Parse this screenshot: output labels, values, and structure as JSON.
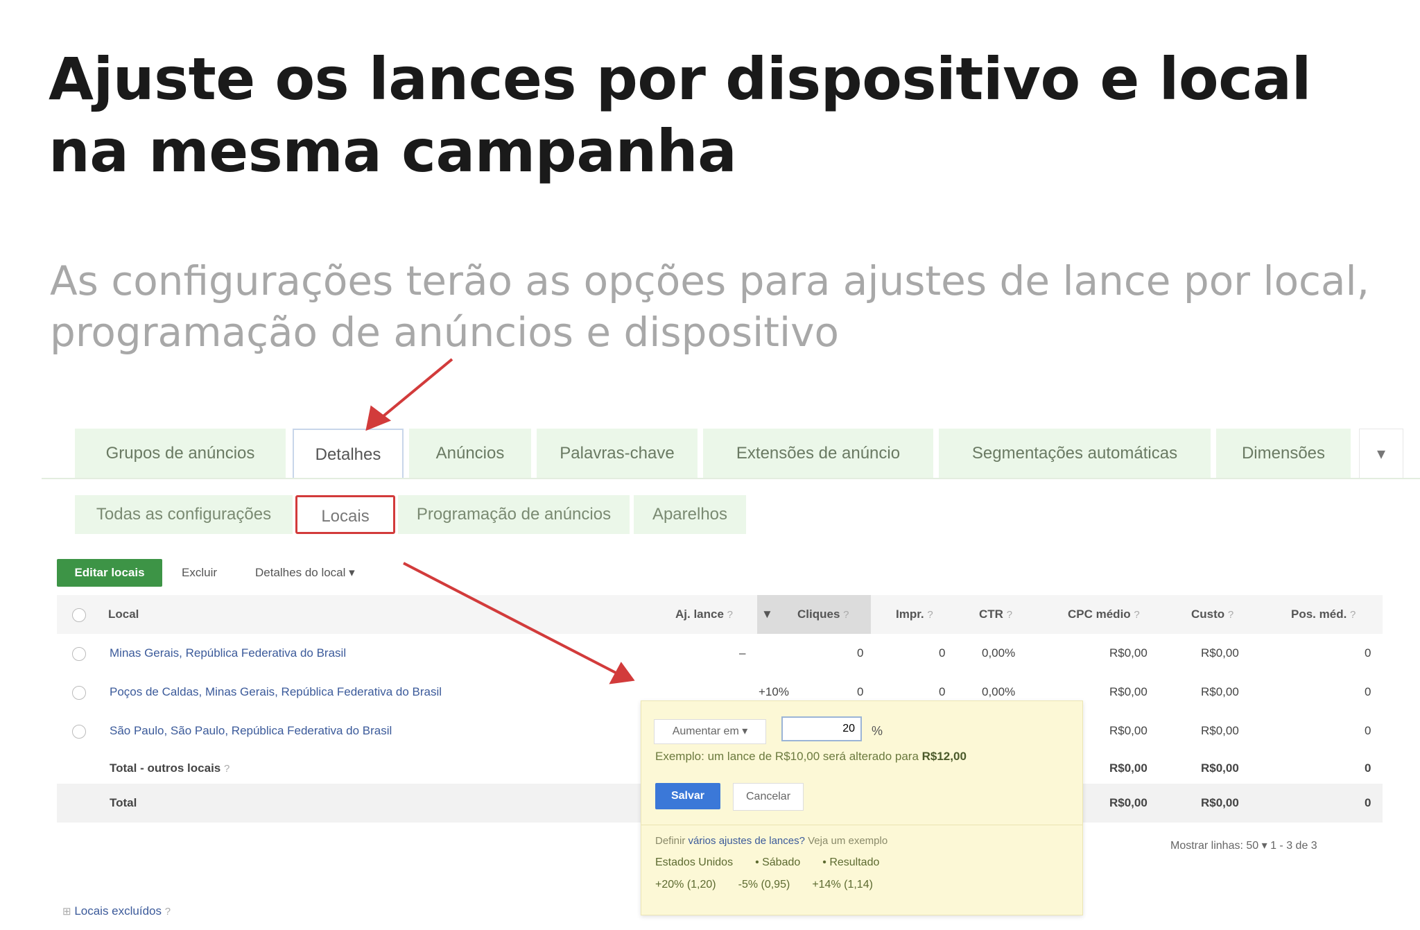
{
  "slide": {
    "title_line1": "Ajuste os lances por dispositivo e local",
    "title_line2": "na mesma campanha",
    "subtitle_line1": "As configurações terão as opções para ajustes de lance por local,",
    "subtitle_line2": "programação de anúncios e dispositivo"
  },
  "main_tabs": [
    {
      "label": "Grupos de anúncios"
    },
    {
      "label": "Detalhes"
    },
    {
      "label": "Anúncios"
    },
    {
      "label": "Palavras-chave"
    },
    {
      "label": "Extensões de anúncio"
    },
    {
      "label": "Segmentações automáticas"
    },
    {
      "label": "Dimensões"
    },
    {
      "label": "▾"
    }
  ],
  "sub_tabs": [
    {
      "label": "Todas as configurações"
    },
    {
      "label": "Locais"
    },
    {
      "label": "Programação de anúncios"
    },
    {
      "label": "Aparelhos"
    }
  ],
  "toolbar": {
    "edit_label": "Editar locais",
    "delete_label": "Excluir",
    "details_label": "Detalhes do local ▾"
  },
  "table": {
    "headers": {
      "location": "Local",
      "bid_adj": "Aj. lance",
      "clicks": "Cliques",
      "impressions": "Impr.",
      "ctr": "CTR",
      "avg_cpc": "CPC médio",
      "cost": "Custo",
      "avg_pos": "Pos. méd.",
      "help": "?",
      "sort_icon": "▼"
    },
    "rows": [
      {
        "location": "Minas Gerais, República Federativa do Brasil",
        "bid_adj": "–",
        "clicks": "0",
        "impressions": "0",
        "ctr": "0,00%",
        "avg_cpc": "R$0,00",
        "cost": "R$0,00",
        "avg_pos": "0"
      },
      {
        "location": "Poços de Caldas, Minas Gerais, República Federativa do Brasil",
        "bid_adj": "+10%",
        "clicks": "0",
        "impressions": "0",
        "ctr": "0,00%",
        "avg_cpc": "R$0,00",
        "cost": "R$0,00",
        "avg_pos": "0"
      },
      {
        "location": "São Paulo, São Paulo, República Federativa do Brasil",
        "avg_cpc": "R$0,00",
        "cost": "R$0,00",
        "avg_pos": "0"
      }
    ],
    "total_other": {
      "label": "Total - outros locais",
      "avg_cpc": "R$0,00",
      "cost": "R$0,00",
      "avg_pos": "0"
    },
    "total": {
      "label": "Total",
      "avg_cpc": "R$0,00",
      "cost": "R$0,00",
      "avg_pos": "0"
    }
  },
  "popup": {
    "select_label": "Aumentar em ▾",
    "input_value": "20",
    "percent": "%",
    "example_prefix": "Exemplo: um lance de R$10,00 será alterado para ",
    "example_value": "R$12,00",
    "save_label": "Salvar",
    "cancel_label": "Cancelar",
    "multi_prefix": "Definir ",
    "multi_link": "vários ajustes de lances?",
    "multi_suffix": " Veja um exemplo",
    "combo_labels": [
      "Estados Unidos",
      "• Sábado",
      "• Resultado"
    ],
    "combo_values": [
      "+20% (1,20)",
      "-5% (0,95)",
      "+14% (1,14)"
    ]
  },
  "pagination": {
    "text": "Mostrar linhas:  50  ▾   1 - 3 de 3"
  },
  "footer": {
    "excluded_icon": "⊞",
    "excluded_label": "Locais excluídos",
    "help": "?"
  },
  "colors": {
    "accent_green": "#3d9446",
    "tab_green": "#ebf7e9",
    "highlight_red": "#d23b3b",
    "popup_yellow": "#fcf8d6",
    "save_blue": "#3b78d8"
  }
}
